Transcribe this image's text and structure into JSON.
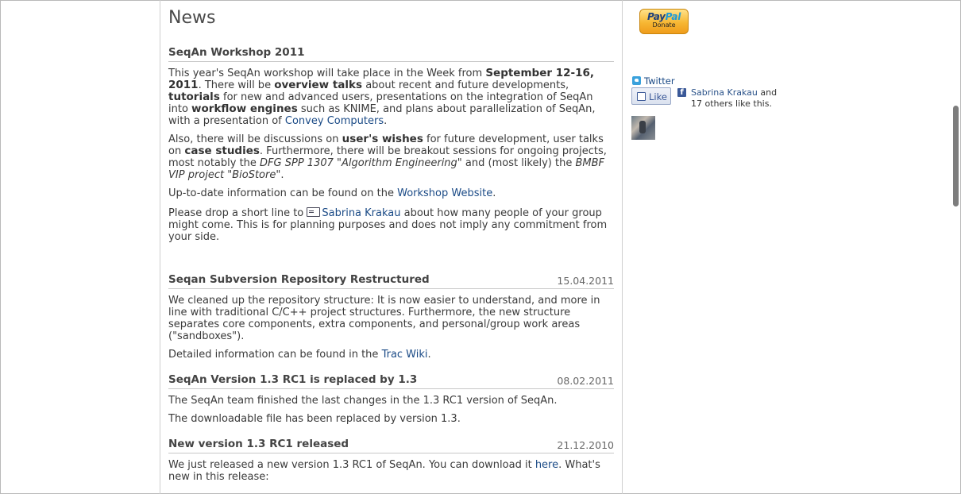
{
  "page": {
    "title": "News"
  },
  "sidebar": {
    "paypal": {
      "brand_pay": "Pay",
      "brand_pal": "Pal",
      "label": "Donate"
    },
    "twitter": {
      "label": "Twitter"
    },
    "facebook": {
      "like_label": "Like",
      "fb_letter": "f",
      "person": "Sabrina Krakau",
      "and": " and",
      "others": "17 others like this."
    }
  },
  "workshop": {
    "title": "SeqAn Workshop 2011",
    "p1": [
      "This year's SeqAn workshop will take place in the Week from ",
      "September 12-16, 2011",
      ". There will be ",
      "overview talks",
      " about recent and future developments, ",
      "tutorials",
      " for new and advanced users, presentations on the integration of SeqAn into ",
      "workflow engines",
      " such as KNIME, and plans about parallelization of SeqAn, with a presentation of ",
      "Convey Computers",
      "."
    ],
    "p2": [
      "Also, there will be discussions on ",
      "user's wishes",
      " for future development, user talks on ",
      "case studies",
      ". Furthermore, there will be breakout sessions for ongoing projects, most notably the ",
      "DFG SPP 1307 \"Algorithm Engineering\"",
      " and (most likely) the ",
      "BMBF VIP project \"BioStore\"",
      "."
    ],
    "p3": [
      "Up-to-date information can be found on the ",
      "Workshop Website",
      "."
    ],
    "p4": [
      "Please drop a short line to ",
      "Sabrina Krakau",
      " about how many people of your group might come. This is for planning purposes and does not imply any commitment from your side."
    ]
  },
  "news": [
    {
      "title": "Seqan Subversion Repository Restructured",
      "date": "15.04.2011",
      "p1": "We cleaned up the repository structure: It is now easier to understand, and more in line with traditional C/C++ project structures. Furthermore, the new structure separates core components, extra components, and personal/group work areas (\"sandboxes\").",
      "p2": [
        "Detailed information can be found in the ",
        "Trac Wiki",
        "."
      ]
    },
    {
      "title": "SeqAn Version 1.3 RC1 is replaced by 1.3",
      "date": "08.02.2011",
      "p1": "The SeqAn team finished the last changes in the 1.3 RC1 version of SeqAn.",
      "p2": "The downloadable file has been replaced by version 1.3."
    },
    {
      "title": "New version 1.3 RC1 released",
      "date": "21.12.2010",
      "p1": [
        "We just released a new version 1.3 RC1 of SeqAn. You can download it ",
        "here",
        ". What's new in this release:"
      ]
    }
  ],
  "colors": {
    "link": "#1a4a86",
    "text": "#3a3a3a",
    "rule": "#c8c8c8"
  }
}
